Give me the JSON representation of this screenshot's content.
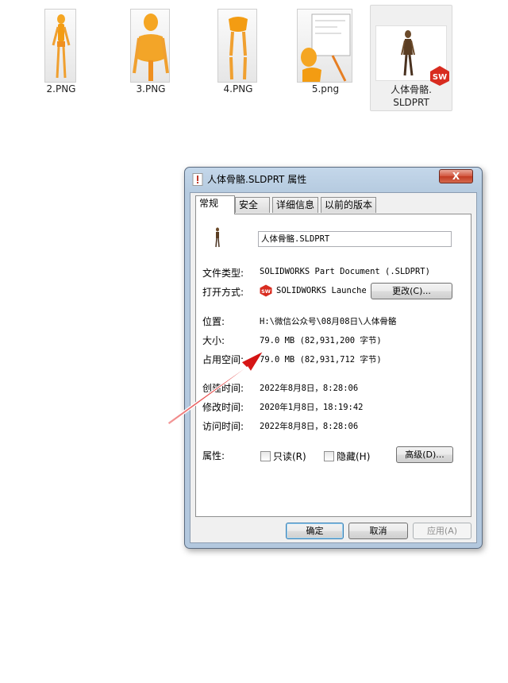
{
  "files": [
    {
      "name": "2.PNG"
    },
    {
      "name": "3.PNG"
    },
    {
      "name": "4.PNG"
    },
    {
      "name": "5.png"
    },
    {
      "name_line1": "人体骨骼.",
      "name_line2": "SLDPRT"
    }
  ],
  "dialog": {
    "title": "人体骨骼.SLDPRT 属性",
    "close_label": "X",
    "tabs": [
      {
        "label": "常规"
      },
      {
        "label": "安全"
      },
      {
        "label": "详细信息"
      },
      {
        "label": "以前的版本"
      }
    ],
    "general": {
      "file_name": "人体骨骼.SLDPRT",
      "type_label": "文件类型:",
      "type_value": "SOLIDWORKS Part Document (.SLDPRT)",
      "open_with_label": "打开方式:",
      "open_with_value": "SOLIDWORKS Launcher",
      "change_button": "更改(C)...",
      "location_label": "位置:",
      "location_value": "H:\\微信公众号\\08月08日\\人体骨骼",
      "size_label": "大小:",
      "size_value": "79.0 MB (82,931,200 字节)",
      "disk_size_label": "占用空间:",
      "disk_size_value": "79.0 MB (82,931,712 字节)",
      "created_label": "创建时间:",
      "created_value": "2022年8月8日，8:28:06",
      "modified_label": "修改时间:",
      "modified_value": "2020年1月8日，18:19:42",
      "accessed_label": "访问时间:",
      "accessed_value": "2022年8月8日，8:28:06",
      "attributes_label": "属性:",
      "readonly_label": "只读(R)",
      "hidden_label": "隐藏(H)",
      "advanced_button": "高级(D)..."
    },
    "buttons": {
      "ok": "确定",
      "cancel": "取消",
      "apply": "应用(A)"
    }
  },
  "colors": {
    "arrow": "#e02020",
    "sw_logo": "#d82c20"
  }
}
